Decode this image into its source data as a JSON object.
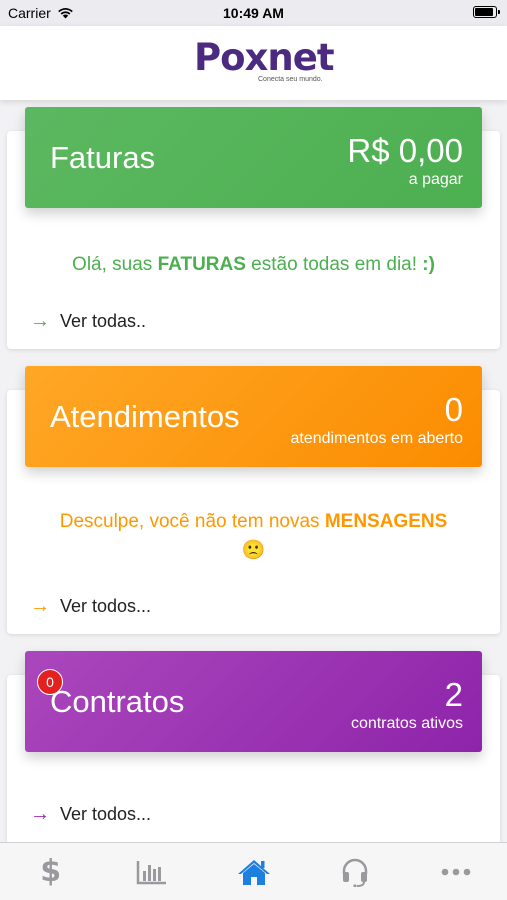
{
  "status_bar": {
    "carrier": "Carrier",
    "time": "10:49 AM",
    "battery_level": 1.0
  },
  "header": {
    "logo_text": "Poxnet",
    "tagline": "Conecta seu mundo."
  },
  "faturas": {
    "title": "Faturas",
    "value": "R$ 0,00",
    "sub": "a pagar",
    "message_pre": "Olá, suas ",
    "message_bold": "FATURAS",
    "message_post": " estão todas em dia! ",
    "message_smiley": ":)",
    "link": "Ver todas..",
    "color": "#4caf50",
    "text_color": "#4caf50"
  },
  "atendimentos": {
    "title": "Atendimentos",
    "value": "0",
    "sub": "atendimentos em aberto",
    "message_pre": "Desculpe, você não tem novas ",
    "message_bold": "MENSAGENS",
    "message_emoji": "🙁",
    "link": "Ver todos...",
    "color": "#ff9800"
  },
  "contratos": {
    "title": "Contratos",
    "value": "2",
    "sub": "contratos ativos",
    "badge": "0",
    "link": "Ver todos...",
    "color": "#9c27b0"
  },
  "tabbar": {
    "active": "home",
    "items": [
      {
        "icon": "dollar-icon"
      },
      {
        "icon": "bar-chart-icon"
      },
      {
        "icon": "home-icon"
      },
      {
        "icon": "headset-icon"
      },
      {
        "icon": "more-icon"
      }
    ]
  }
}
